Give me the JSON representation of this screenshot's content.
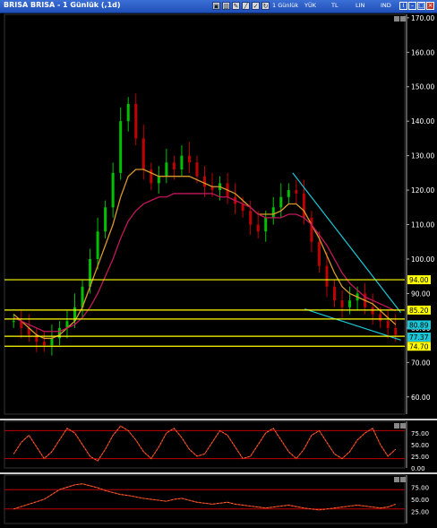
{
  "window": {
    "title": "BRISA BRISA - 1 Günlük (,1d)",
    "toolbar_icons": [
      "period-icon",
      "chart-icon",
      "pencil-icon",
      "line-icon",
      "check-icon",
      "refresh-icon"
    ],
    "toolbar_period": "1 Günlük",
    "toolbar_labels": [
      "YÜK",
      "TL",
      "LIN",
      "IND"
    ]
  },
  "colors": {
    "background": "#000000",
    "bull_candle": "#00c000",
    "bear_candle": "#c00000",
    "ma_fast": "#d99a2b",
    "ma_slow": "#c0185a",
    "support_lines": "#ffff00",
    "trend_lines": "#19c7d6",
    "oscillator_bands": "#c00000"
  },
  "chart_data": [
    {
      "type": "candlestick",
      "title": "BRISA BRISA - 1 Günlük (,1d)",
      "y_ticks": [
        "170.00",
        "160.00",
        "150.00",
        "140.00",
        "130.00",
        "120.00",
        "110.00",
        "100.00",
        "90.00",
        "80.00",
        "70.00",
        "60.00"
      ],
      "ylim": [
        55,
        171
      ],
      "horizontal_levels": [
        {
          "value": 94.0,
          "label": "94.00"
        },
        {
          "value": 85.2,
          "label": "85.20"
        },
        {
          "value": 82.6,
          "label": ""
        },
        {
          "value": 77.6,
          "label": ""
        },
        {
          "value": 74.7,
          "label": "74.70"
        }
      ],
      "price_tags": [
        {
          "value": 80.89,
          "label": "80.89"
        },
        {
          "value": 77.37,
          "label": "77.37"
        }
      ],
      "trend_lines": [
        {
          "from": [
            0.72,
            125.0
          ],
          "to": [
            0.99,
            84.5
          ]
        },
        {
          "from": [
            0.75,
            85.5
          ],
          "to": [
            0.99,
            76.5
          ]
        }
      ],
      "close_series": [
        82,
        80,
        78,
        76,
        75,
        77,
        80,
        82,
        86,
        92,
        100,
        108,
        115,
        125,
        140,
        145,
        135,
        126,
        122,
        124,
        128,
        126,
        130,
        128,
        124,
        121,
        120,
        122,
        118,
        116,
        114,
        110,
        108,
        112,
        115,
        118,
        120,
        119,
        112,
        105,
        98,
        92,
        88,
        86,
        88,
        90,
        86,
        84,
        82,
        80,
        78
      ],
      "ma_fast_series": [
        84,
        82,
        80,
        78,
        77,
        77,
        78,
        80,
        82,
        86,
        92,
        98,
        104,
        110,
        118,
        124,
        126,
        126,
        125,
        124,
        124,
        124,
        124,
        124,
        123,
        122,
        121,
        121,
        120,
        119,
        117,
        115,
        113,
        113,
        113,
        114,
        116,
        116,
        114,
        110,
        106,
        101,
        96,
        92,
        90,
        89,
        88,
        87,
        85,
        83,
        81
      ],
      "ma_slow_series": [
        83,
        82,
        81,
        80,
        79,
        79,
        79,
        80,
        81,
        83,
        86,
        90,
        95,
        100,
        106,
        111,
        114,
        116,
        117,
        118,
        118,
        119,
        119,
        119,
        119,
        119,
        119,
        118,
        118,
        117,
        116,
        115,
        113,
        112,
        112,
        112,
        113,
        113,
        112,
        110,
        107,
        104,
        100,
        96,
        93,
        91,
        89,
        88,
        87,
        86,
        85
      ]
    },
    {
      "type": "line",
      "title": "",
      "y_ticks": [
        "75.00",
        "50.00",
        "25.00",
        "0.00"
      ],
      "ylim": [
        0,
        100
      ],
      "bands": [
        80,
        20
      ],
      "values": [
        30,
        55,
        70,
        45,
        20,
        35,
        60,
        85,
        75,
        50,
        25,
        15,
        40,
        70,
        90,
        80,
        60,
        35,
        20,
        45,
        75,
        85,
        65,
        40,
        25,
        30,
        55,
        80,
        70,
        45,
        20,
        25,
        50,
        75,
        85,
        60,
        35,
        20,
        40,
        70,
        80,
        55,
        30,
        20,
        35,
        60,
        75,
        85,
        50,
        25,
        40
      ]
    },
    {
      "type": "line",
      "title": "",
      "y_ticks": [
        "75.00",
        "50.00",
        "25.00"
      ],
      "ylim": [
        0,
        100
      ],
      "bands": [
        70,
        30
      ],
      "values": [
        30,
        35,
        40,
        45,
        50,
        60,
        70,
        75,
        80,
        82,
        78,
        74,
        68,
        64,
        60,
        58,
        55,
        52,
        50,
        48,
        46,
        50,
        52,
        48,
        44,
        42,
        40,
        42,
        44,
        40,
        38,
        36,
        34,
        32,
        34,
        36,
        38,
        35,
        32,
        30,
        28,
        30,
        32,
        34,
        36,
        38,
        36,
        34,
        32,
        34,
        40
      ]
    }
  ]
}
